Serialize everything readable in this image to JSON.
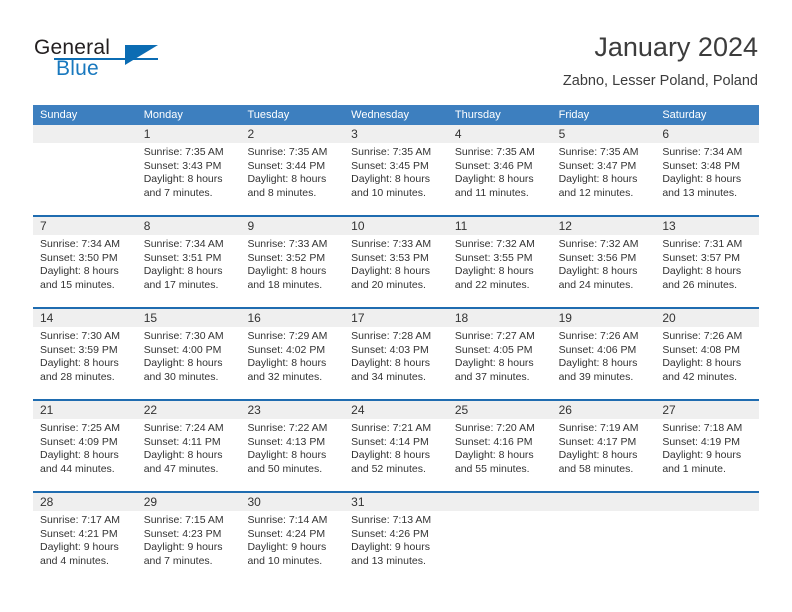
{
  "brand": {
    "word1": "General",
    "word2": "Blue",
    "logo_icon": "blue-triangle-logo"
  },
  "header": {
    "title": "January 2024",
    "location": "Zabno, Lesser Poland, Poland"
  },
  "colors": {
    "header_blue": "#3d7fbf",
    "separator_blue": "#1f6cb0",
    "daynum_band": "#efefef",
    "brand_blue": "#1878be",
    "text": "#333333"
  },
  "weekdays": [
    "Sunday",
    "Monday",
    "Tuesday",
    "Wednesday",
    "Thursday",
    "Friday",
    "Saturday"
  ],
  "weeks": [
    [
      {
        "day": "",
        "lines": []
      },
      {
        "day": "1",
        "lines": [
          "Sunrise: 7:35 AM",
          "Sunset: 3:43 PM",
          "Daylight: 8 hours",
          "and 7 minutes."
        ]
      },
      {
        "day": "2",
        "lines": [
          "Sunrise: 7:35 AM",
          "Sunset: 3:44 PM",
          "Daylight: 8 hours",
          "and 8 minutes."
        ]
      },
      {
        "day": "3",
        "lines": [
          "Sunrise: 7:35 AM",
          "Sunset: 3:45 PM",
          "Daylight: 8 hours",
          "and 10 minutes."
        ]
      },
      {
        "day": "4",
        "lines": [
          "Sunrise: 7:35 AM",
          "Sunset: 3:46 PM",
          "Daylight: 8 hours",
          "and 11 minutes."
        ]
      },
      {
        "day": "5",
        "lines": [
          "Sunrise: 7:35 AM",
          "Sunset: 3:47 PM",
          "Daylight: 8 hours",
          "and 12 minutes."
        ]
      },
      {
        "day": "6",
        "lines": [
          "Sunrise: 7:34 AM",
          "Sunset: 3:48 PM",
          "Daylight: 8 hours",
          "and 13 minutes."
        ]
      }
    ],
    [
      {
        "day": "7",
        "lines": [
          "Sunrise: 7:34 AM",
          "Sunset: 3:50 PM",
          "Daylight: 8 hours",
          "and 15 minutes."
        ]
      },
      {
        "day": "8",
        "lines": [
          "Sunrise: 7:34 AM",
          "Sunset: 3:51 PM",
          "Daylight: 8 hours",
          "and 17 minutes."
        ]
      },
      {
        "day": "9",
        "lines": [
          "Sunrise: 7:33 AM",
          "Sunset: 3:52 PM",
          "Daylight: 8 hours",
          "and 18 minutes."
        ]
      },
      {
        "day": "10",
        "lines": [
          "Sunrise: 7:33 AM",
          "Sunset: 3:53 PM",
          "Daylight: 8 hours",
          "and 20 minutes."
        ]
      },
      {
        "day": "11",
        "lines": [
          "Sunrise: 7:32 AM",
          "Sunset: 3:55 PM",
          "Daylight: 8 hours",
          "and 22 minutes."
        ]
      },
      {
        "day": "12",
        "lines": [
          "Sunrise: 7:32 AM",
          "Sunset: 3:56 PM",
          "Daylight: 8 hours",
          "and 24 minutes."
        ]
      },
      {
        "day": "13",
        "lines": [
          "Sunrise: 7:31 AM",
          "Sunset: 3:57 PM",
          "Daylight: 8 hours",
          "and 26 minutes."
        ]
      }
    ],
    [
      {
        "day": "14",
        "lines": [
          "Sunrise: 7:30 AM",
          "Sunset: 3:59 PM",
          "Daylight: 8 hours",
          "and 28 minutes."
        ]
      },
      {
        "day": "15",
        "lines": [
          "Sunrise: 7:30 AM",
          "Sunset: 4:00 PM",
          "Daylight: 8 hours",
          "and 30 minutes."
        ]
      },
      {
        "day": "16",
        "lines": [
          "Sunrise: 7:29 AM",
          "Sunset: 4:02 PM",
          "Daylight: 8 hours",
          "and 32 minutes."
        ]
      },
      {
        "day": "17",
        "lines": [
          "Sunrise: 7:28 AM",
          "Sunset: 4:03 PM",
          "Daylight: 8 hours",
          "and 34 minutes."
        ]
      },
      {
        "day": "18",
        "lines": [
          "Sunrise: 7:27 AM",
          "Sunset: 4:05 PM",
          "Daylight: 8 hours",
          "and 37 minutes."
        ]
      },
      {
        "day": "19",
        "lines": [
          "Sunrise: 7:26 AM",
          "Sunset: 4:06 PM",
          "Daylight: 8 hours",
          "and 39 minutes."
        ]
      },
      {
        "day": "20",
        "lines": [
          "Sunrise: 7:26 AM",
          "Sunset: 4:08 PM",
          "Daylight: 8 hours",
          "and 42 minutes."
        ]
      }
    ],
    [
      {
        "day": "21",
        "lines": [
          "Sunrise: 7:25 AM",
          "Sunset: 4:09 PM",
          "Daylight: 8 hours",
          "and 44 minutes."
        ]
      },
      {
        "day": "22",
        "lines": [
          "Sunrise: 7:24 AM",
          "Sunset: 4:11 PM",
          "Daylight: 8 hours",
          "and 47 minutes."
        ]
      },
      {
        "day": "23",
        "lines": [
          "Sunrise: 7:22 AM",
          "Sunset: 4:13 PM",
          "Daylight: 8 hours",
          "and 50 minutes."
        ]
      },
      {
        "day": "24",
        "lines": [
          "Sunrise: 7:21 AM",
          "Sunset: 4:14 PM",
          "Daylight: 8 hours",
          "and 52 minutes."
        ]
      },
      {
        "day": "25",
        "lines": [
          "Sunrise: 7:20 AM",
          "Sunset: 4:16 PM",
          "Daylight: 8 hours",
          "and 55 minutes."
        ]
      },
      {
        "day": "26",
        "lines": [
          "Sunrise: 7:19 AM",
          "Sunset: 4:17 PM",
          "Daylight: 8 hours",
          "and 58 minutes."
        ]
      },
      {
        "day": "27",
        "lines": [
          "Sunrise: 7:18 AM",
          "Sunset: 4:19 PM",
          "Daylight: 9 hours",
          "and 1 minute."
        ]
      }
    ],
    [
      {
        "day": "28",
        "lines": [
          "Sunrise: 7:17 AM",
          "Sunset: 4:21 PM",
          "Daylight: 9 hours",
          "and 4 minutes."
        ]
      },
      {
        "day": "29",
        "lines": [
          "Sunrise: 7:15 AM",
          "Sunset: 4:23 PM",
          "Daylight: 9 hours",
          "and 7 minutes."
        ]
      },
      {
        "day": "30",
        "lines": [
          "Sunrise: 7:14 AM",
          "Sunset: 4:24 PM",
          "Daylight: 9 hours",
          "and 10 minutes."
        ]
      },
      {
        "day": "31",
        "lines": [
          "Sunrise: 7:13 AM",
          "Sunset: 4:26 PM",
          "Daylight: 9 hours",
          "and 13 minutes."
        ]
      },
      {
        "day": "",
        "lines": []
      },
      {
        "day": "",
        "lines": []
      },
      {
        "day": "",
        "lines": []
      }
    ]
  ]
}
